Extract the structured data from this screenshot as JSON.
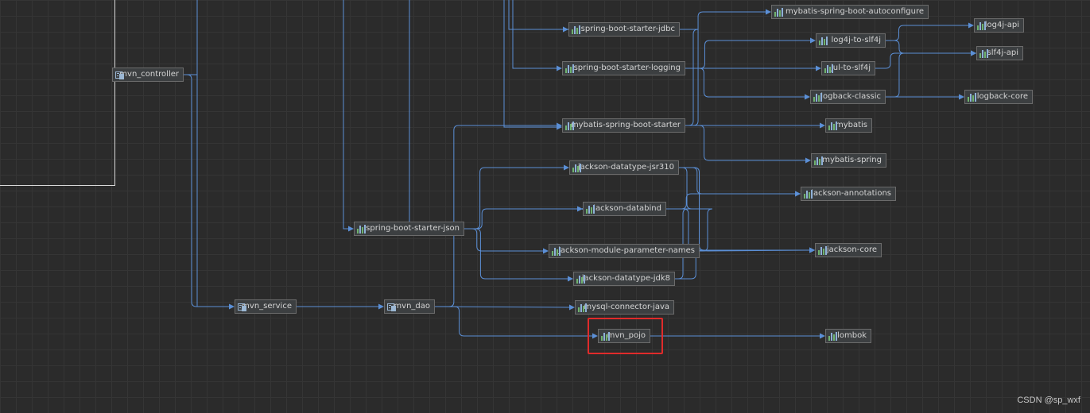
{
  "colors": {
    "edge": "#5b8fd6",
    "highlight": "#e02b2b",
    "background": "#2b2b2b"
  },
  "nodes": [
    {
      "id": "mvn_controller",
      "label": "mvn_controller",
      "icon": "module-icon"
    },
    {
      "id": "mvn_service",
      "label": "mvn_service",
      "icon": "module-icon"
    },
    {
      "id": "mvn_dao",
      "label": "mvn_dao",
      "icon": "module-icon"
    },
    {
      "id": "spring-boot-starter-json",
      "label": "spring-boot-starter-json",
      "icon": "library-icon"
    },
    {
      "id": "spring-boot-starter-jdbc",
      "label": "spring-boot-starter-jdbc",
      "icon": "library-icon"
    },
    {
      "id": "spring-boot-starter-logging",
      "label": "spring-boot-starter-logging",
      "icon": "library-icon"
    },
    {
      "id": "mybatis-spring-boot-starter",
      "label": "mybatis-spring-boot-starter",
      "icon": "library-icon"
    },
    {
      "id": "mybatis-spring-boot-autoconfigure",
      "label": "mybatis-spring-boot-autoconfigure",
      "icon": "library-icon"
    },
    {
      "id": "log4j-api",
      "label": "log4j-api",
      "icon": "library-icon"
    },
    {
      "id": "log4j-to-slf4j",
      "label": "log4j-to-slf4j",
      "icon": "library-icon"
    },
    {
      "id": "slf4j-api",
      "label": "slf4j-api",
      "icon": "library-icon"
    },
    {
      "id": "jul-to-slf4j",
      "label": "jul-to-slf4j",
      "icon": "library-icon"
    },
    {
      "id": "logback-classic",
      "label": "logback-classic",
      "icon": "library-icon"
    },
    {
      "id": "logback-core",
      "label": "logback-core",
      "icon": "library-icon"
    },
    {
      "id": "mybatis",
      "label": "mybatis",
      "icon": "library-icon"
    },
    {
      "id": "mybatis-spring",
      "label": "mybatis-spring",
      "icon": "library-icon"
    },
    {
      "id": "jackson-datatype-jsr310",
      "label": "jackson-datatype-jsr310",
      "icon": "library-icon"
    },
    {
      "id": "jackson-annotations",
      "label": "jackson-annotations",
      "icon": "library-icon"
    },
    {
      "id": "jackson-databind",
      "label": "jackson-databind",
      "icon": "library-icon"
    },
    {
      "id": "jackson-module-parameter-names",
      "label": "jackson-module-parameter-names",
      "icon": "library-icon"
    },
    {
      "id": "jackson-core",
      "label": "jackson-core",
      "icon": "library-icon"
    },
    {
      "id": "jackson-datatype-jdk8",
      "label": "jackson-datatype-jdk8",
      "icon": "library-icon"
    },
    {
      "id": "mysql-connector-java",
      "label": "mysql-connector-java",
      "icon": "library-icon"
    },
    {
      "id": "mvn_pojo",
      "label": "mvn_pojo",
      "icon": "library-icon",
      "highlighted": true
    },
    {
      "id": "lombok",
      "label": "lombok",
      "icon": "library-icon"
    }
  ],
  "edges": [
    [
      "mvn_controller",
      "mvn_service"
    ],
    [
      "mvn_service",
      "mvn_dao"
    ],
    [
      "mvn_dao",
      "mybatis-spring-boot-starter"
    ],
    [
      "mvn_dao",
      "mysql-connector-java"
    ],
    [
      "mvn_dao",
      "mvn_pojo"
    ],
    [
      "mvn_pojo",
      "lombok"
    ],
    [
      "spring-boot-starter-json",
      "jackson-datatype-jsr310"
    ],
    [
      "spring-boot-starter-json",
      "jackson-databind"
    ],
    [
      "spring-boot-starter-json",
      "jackson-module-parameter-names"
    ],
    [
      "spring-boot-starter-json",
      "jackson-datatype-jdk8"
    ],
    [
      "jackson-datatype-jsr310",
      "jackson-annotations"
    ],
    [
      "jackson-datatype-jsr310",
      "jackson-databind"
    ],
    [
      "jackson-datatype-jsr310",
      "jackson-core"
    ],
    [
      "jackson-module-parameter-names",
      "jackson-databind"
    ],
    [
      "jackson-datatype-jdk8",
      "jackson-databind"
    ],
    [
      "jackson-databind",
      "jackson-annotations"
    ],
    [
      "jackson-databind",
      "jackson-core"
    ],
    [
      "jackson-module-parameter-names",
      "jackson-core"
    ],
    [
      "jackson-datatype-jdk8",
      "jackson-core"
    ],
    [
      "mybatis-spring-boot-starter",
      "mybatis-spring-boot-autoconfigure"
    ],
    [
      "mybatis-spring-boot-starter",
      "spring-boot-starter-jdbc"
    ],
    [
      "mybatis-spring-boot-starter",
      "mybatis"
    ],
    [
      "mybatis-spring-boot-starter",
      "mybatis-spring"
    ],
    [
      "spring-boot-starter-logging",
      "log4j-to-slf4j"
    ],
    [
      "spring-boot-starter-logging",
      "jul-to-slf4j"
    ],
    [
      "spring-boot-starter-logging",
      "logback-classic"
    ],
    [
      "log4j-to-slf4j",
      "log4j-api"
    ],
    [
      "log4j-to-slf4j",
      "slf4j-api"
    ],
    [
      "jul-to-slf4j",
      "slf4j-api"
    ],
    [
      "logback-classic",
      "logback-core"
    ],
    [
      "logback-classic",
      "slf4j-api"
    ]
  ],
  "watermark": "CSDN @sp_wxf"
}
